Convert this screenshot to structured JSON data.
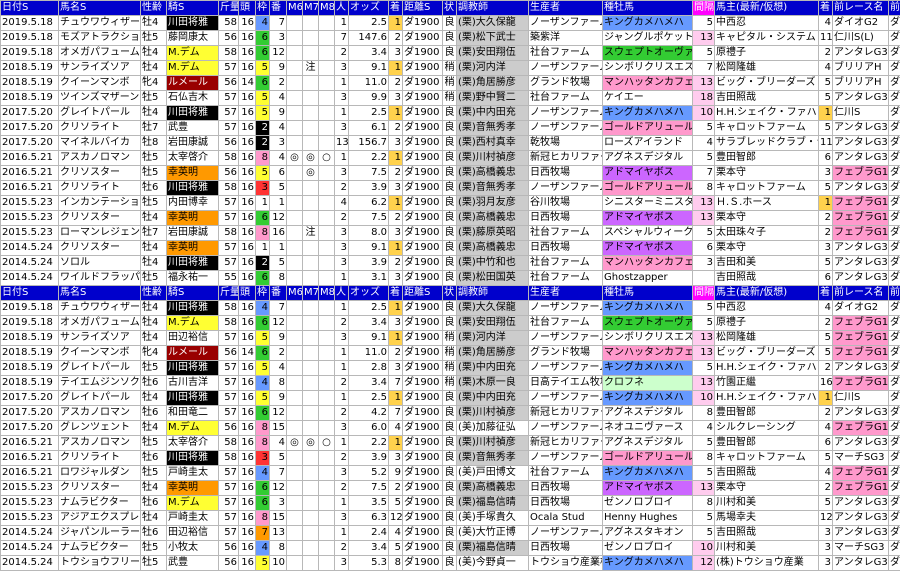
{
  "header": [
    "日付S",
    "馬名S",
    "性齢",
    "騎S",
    "斤量",
    "頭",
    "枠",
    "番",
    "M6",
    "M7",
    "M8",
    "人",
    "オッズ",
    "着",
    "距離S",
    "状",
    "調教師",
    "生産者",
    "種牡馬",
    "間隔",
    "馬主(最新/仮想)",
    "着",
    "前レース名",
    "前距離",
    "人"
  ],
  "header2": [
    "日付S",
    "馬名S",
    "性齢",
    "騎S",
    "斤量",
    "頭",
    "枠",
    "番",
    "M6",
    "M7",
    "M8",
    "人",
    "オッズ",
    "着",
    "距離S",
    "状",
    "調教師",
    "生産者",
    "種牡馬",
    "間隔",
    "馬主(最新/仮想)",
    "着",
    "前レース名",
    "前距離",
    "人"
  ],
  "rows1": [
    [
      "2019.5.18",
      "チュウワウィザード",
      "牡4",
      "川田将雅",
      "58",
      "16",
      "4",
      "7",
      "",
      "",
      "",
      "1",
      "2.5",
      "1",
      "ダ1900",
      "良",
      "(栗)大久保龍",
      "ノーザンファーム",
      "キングカメハメハ",
      "5",
      "中西忍",
      "4",
      "ダイオG2",
      "ダ2400",
      "1"
    ],
    [
      "2019.5.18",
      "モズアトラクション",
      "牡5",
      "藤岡康太",
      "56",
      "16",
      "6",
      "3",
      "",
      "",
      "",
      "7",
      "147.6",
      "2",
      "ダ1900",
      "良",
      "(栗)松下武士",
      "築紫洋",
      "ジャングルポケット",
      "13",
      "キャピタル・システム",
      "11",
      "仁川S(L)",
      "ダ2000",
      "3"
    ],
    [
      "2019.5.18",
      "オメガパフューム",
      "牡4",
      "M.デム",
      "58",
      "16",
      "6",
      "12",
      "",
      "",
      "",
      "2",
      "3.4",
      "3",
      "ダ1900",
      "良",
      "(栗)安田翔伍",
      "社台ファーム",
      "スウェプトオーヴァーボード",
      "5",
      "原禮子",
      "2",
      "アンタレG3",
      "ダ1600",
      "3"
    ],
    [
      "2018.5.19",
      "サンライズソア",
      "牡4",
      "M.デム",
      "57",
      "16",
      "5",
      "9",
      "",
      "注",
      "",
      "3",
      "9.1",
      "1",
      "ダ1900",
      "稍",
      "(栗)河内洋",
      "ノーザンファーム",
      "シンボリクリスエス",
      "7",
      "松岡隆雄",
      "4",
      "ブリリアH",
      "ダ2000",
      "1"
    ],
    [
      "2018.5.19",
      "クイーンマンボ",
      "牝4",
      "ルメール",
      "56",
      "14",
      "6",
      "2",
      "",
      "",
      "",
      "1",
      "11.0",
      "2",
      "ダ1900",
      "稍",
      "(栗)角居勝彦",
      "グランド牧場",
      "マンハッタンカフェ",
      "13",
      "ビッグ・ブリーダーズ・ファーム",
      "5",
      "ブリリアH",
      "ダ1600",
      "1"
    ],
    [
      "2018.5.19",
      "ツインズマザーン",
      "牡5",
      "石仏吉木",
      "57",
      "16",
      "5",
      "4",
      "",
      "",
      "",
      "3",
      "9.9",
      "3",
      "ダ1900",
      "稍",
      "(栗)野中賢二",
      "社台ファーム",
      "ケイエー",
      "18",
      "吉田照哉",
      "5",
      "アンタレG3",
      "ダ1800",
      "1"
    ],
    [
      "2017.5.20",
      "グレイトパール",
      "牡4",
      "川田将雅",
      "57",
      "16",
      "5",
      "9",
      "",
      "",
      "",
      "1",
      "2.5",
      "1",
      "ダ1900",
      "良",
      "(栗)中内田充",
      "ノーザンファーム",
      "キングカメハメハ",
      "10",
      "H.H.シェイク・ファハド",
      "1",
      "仁川S",
      "ダ2000",
      "1"
    ],
    [
      "2017.5.20",
      "クリソライト",
      "牡7",
      "武豊",
      "57",
      "16",
      "2",
      "4",
      "",
      "",
      "",
      "3",
      "6.1",
      "2",
      "ダ1900",
      "良",
      "(栗)音無秀孝",
      "ノーザンファーム",
      "ゴールドアリュール",
      "5",
      "キャロットファーム",
      "5",
      "アンタレG3",
      "ダ1800",
      "1"
    ],
    [
      "2017.5.20",
      "マイネルバイカ",
      "牡8",
      "岩田康誠",
      "56",
      "16",
      "2",
      "3",
      "",
      "",
      "",
      "13",
      "156.7",
      "3",
      "ダ1900",
      "良",
      "(栗)西村真幸",
      "乾牧場",
      "ローズアイランド",
      "4",
      "サラブレッドクラブ・ラフィアン",
      "11",
      "アンタレG3",
      "ダ1800",
      "14"
    ],
    [
      "2016.5.21",
      "アスカノロマン",
      "牡5",
      "太宰啓介",
      "58",
      "16",
      "8",
      "4",
      "◎",
      "◎",
      "○",
      "1",
      "2.2",
      "1",
      "ダ1900",
      "良",
      "(栗)川村禎彦",
      "新冠ヒカリファーム",
      "アグネスデジタル",
      "5",
      "豊田智郎",
      "6",
      "アンタレG3",
      "ダ1800",
      "1"
    ],
    [
      "2016.5.21",
      "クリソスター",
      "牡5",
      "幸英明",
      "56",
      "16",
      "5",
      "6",
      "",
      "◎",
      "",
      "3",
      "7.5",
      "2",
      "ダ1900",
      "良",
      "(栗)高橋義忠",
      "日西牧場",
      "アドマイヤボス",
      "7",
      "栗本守",
      "3",
      "フェブラG1",
      "ダ1600",
      "3"
    ],
    [
      "2016.5.21",
      "クリソライト",
      "牡6",
      "川田将雅",
      "58",
      "16",
      "3",
      "5",
      "",
      "",
      "",
      "2",
      "3.9",
      "3",
      "ダ1900",
      "良",
      "(栗)音無秀孝",
      "ノーザンファーム",
      "ゴールドアリュール",
      "8",
      "キャロットファーム",
      "5",
      "アンタレG3",
      "ダ1800",
      "1"
    ],
    [
      "2015.5.23",
      "インカンテーション",
      "牡5",
      "内田博幸",
      "57",
      "16",
      "1",
      "1",
      "",
      "",
      "",
      "4",
      "6.2",
      "1",
      "ダ1900",
      "良",
      "(栗)羽月友彦",
      "谷川牧場",
      "シニスターミニスター",
      "13",
      "Ｈ.Ｓ.ホース",
      "1",
      "フェブラG1",
      "ダ1600",
      "4"
    ],
    [
      "2015.5.23",
      "クリソスター",
      "牡4",
      "幸英明",
      "57",
      "16",
      "6",
      "12",
      "",
      "",
      "",
      "2",
      "7.5",
      "2",
      "ダ1900",
      "良",
      "(栗)高橋義忠",
      "日西牧場",
      "アドマイヤボス",
      "13",
      "栗本守",
      "2",
      "フェブラG1",
      "ダ1600",
      "2"
    ],
    [
      "2015.5.23",
      "ローマンレジェンド",
      "牡7",
      "岩田康誠",
      "58",
      "16",
      "8",
      "16",
      "",
      "注",
      "",
      "3",
      "8.0",
      "3",
      "ダ1900",
      "良",
      "(栗)藤原英昭",
      "社台ファーム",
      "スペシャルウィーク",
      "5",
      "太田珠々子",
      "2",
      "フェブラG1",
      "ダ1600",
      "2"
    ],
    [
      "2014.5.24",
      "クリソスター",
      "牡4",
      "幸英明",
      "57",
      "16",
      "1",
      "1",
      "",
      "",
      "",
      "3",
      "9.1",
      "1",
      "ダ1900",
      "良",
      "(栗)高橋義忠",
      "日西牧場",
      "アドマイヤボス",
      "6",
      "栗本守",
      "3",
      "アンタレG3",
      "ダ1800",
      "3"
    ],
    [
      "2014.5.24",
      "ソロル",
      "牡4",
      "川田将雅",
      "57",
      "16",
      "2",
      "5",
      "",
      "",
      "",
      "3",
      "3.9",
      "2",
      "ダ1900",
      "良",
      "(栗)中竹和也",
      "社台ファーム",
      "マンハッタンカフェ",
      "3",
      "吉田和美",
      "5",
      "アンタレG3",
      "ダ1800",
      "1"
    ],
    [
      "2014.5.24",
      "ワイルドフラッパー",
      "牡5",
      "福永祐一",
      "55",
      "16",
      "6",
      "8",
      "",
      "",
      "",
      "1",
      "3.1",
      "3",
      "ダ1900",
      "良",
      "(栗)松田国英",
      "社台ファーム",
      "Ghostzapper",
      "",
      "吉田照哉",
      "6",
      "アンタレG3",
      "ダ1800",
      "2"
    ]
  ],
  "rows2": [
    [
      "2019.5.18",
      "チュウワウィザード",
      "牡4",
      "川田将雅",
      "58",
      "16",
      "4",
      "7",
      "",
      "",
      "",
      "1",
      "2.5",
      "1",
      "ダ1900",
      "良",
      "(栗)大久保龍",
      "ノーザンファーム",
      "キングカメハメハ",
      "5",
      "中西忍",
      "4",
      "ダイオG2",
      "ダ2400",
      "1"
    ],
    [
      "2019.5.18",
      "オメガパフューム",
      "牡4",
      "M.デム",
      "58",
      "16",
      "6",
      "12",
      "",
      "",
      "",
      "2",
      "3.4",
      "3",
      "ダ1900",
      "良",
      "(栗)安田翔伍",
      "社台ファーム",
      "スウェプトオーヴァーボード",
      "5",
      "原禮子",
      "2",
      "フェブラG1",
      "ダ1600",
      "3"
    ],
    [
      "2018.5.19",
      "サンライズソア",
      "牡4",
      "田辺裕信",
      "57",
      "16",
      "5",
      "9",
      "",
      "",
      "",
      "3",
      "9.1",
      "1",
      "ダ1900",
      "稍",
      "(栗)河内洋",
      "ノーザンファーム",
      "シンボリクリスエス",
      "13",
      "松岡隆雄",
      "5",
      "フェブラG1",
      "ダ1600",
      "3"
    ],
    [
      "2018.5.19",
      "クイーンマンボ",
      "牝4",
      "ルメール",
      "56",
      "14",
      "6",
      "2",
      "",
      "",
      "",
      "1",
      "11.0",
      "2",
      "ダ1900",
      "稍",
      "(栗)角居勝彦",
      "グランド牧場",
      "マンハッタンカフェ",
      "13",
      "ビッグ・ブリーダーズ・ファーム",
      "5",
      "フェブラG1",
      "ダ1600",
      "1"
    ],
    [
      "2018.5.19",
      "グレイトパール",
      "牡5",
      "川田将雅",
      "57",
      "16",
      "5",
      "4",
      "",
      "",
      "",
      "1",
      "2.8",
      "3",
      "ダ1900",
      "稍",
      "(栗)中内田充",
      "ノーザンファーム",
      "キングカメハメハ",
      "5",
      "H.H.シェイク・ファハド",
      "2",
      "アンタレG3",
      "ダ1800",
      "1"
    ],
    [
      "2018.5.19",
      "テイエムジンソク",
      "牡6",
      "古川吉洋",
      "57",
      "16",
      "4",
      "8",
      "",
      "",
      "",
      "2",
      "3.4",
      "7",
      "ダ1900",
      "稍",
      "(栗)木原一良",
      "日高テイエム牧場",
      "クロフネ",
      "13",
      "竹園正繼",
      "16",
      "フェブラG1",
      "ダ1600",
      "2"
    ],
    [
      "2017.5.20",
      "グレイトパール",
      "牡4",
      "川田将雅",
      "57",
      "16",
      "5",
      "9",
      "",
      "",
      "",
      "1",
      "2.5",
      "1",
      "ダ1900",
      "良",
      "(栗)中内田充",
      "ノーザンファーム",
      "キングカメハメハ",
      "10",
      "H.H.シェイク・ファハド",
      "1",
      "仁川S",
      "ダ2000",
      "1"
    ],
    [
      "2017.5.20",
      "アスカノロマン",
      "牡6",
      "和田竜二",
      "57",
      "16",
      "6",
      "12",
      "",
      "",
      "",
      "2",
      "4.2",
      "7",
      "ダ1900",
      "良",
      "(栗)川村禎彦",
      "新冠ヒカリファーム",
      "アグネスデジタル",
      "8",
      "豊田智郎",
      "2",
      "アンタレG3",
      "ダ1800",
      "3"
    ],
    [
      "2017.5.20",
      "グレンツェント",
      "牡4",
      "M.デム",
      "56",
      "16",
      "8",
      "15",
      "",
      "",
      "",
      "3",
      "6.0",
      "4",
      "ダ1900",
      "良",
      "(美)加藤征弘",
      "ノーザンファーム",
      "ネオユニヴァース",
      "4",
      "シルクレーシング",
      "4",
      "フェブラG1",
      "ダ1600",
      "3"
    ],
    [
      "2016.5.21",
      "アスカノロマン",
      "牡5",
      "太宰啓介",
      "58",
      "16",
      "8",
      "4",
      "◎",
      "◎",
      "○",
      "1",
      "2.2",
      "1",
      "ダ1900",
      "良",
      "(栗)川村禎彦",
      "新冠ヒカリファーム",
      "アグネスデジタル",
      "5",
      "豊田智郎",
      "6",
      "アンタレG3",
      "ダ1800",
      "1"
    ],
    [
      "2016.5.21",
      "クリソライト",
      "牡6",
      "川田将雅",
      "58",
      "16",
      "3",
      "5",
      "",
      "",
      "",
      "2",
      "3.9",
      "3",
      "ダ1900",
      "良",
      "(栗)音無秀孝",
      "ノーザンファーム",
      "ゴールドアリュール",
      "8",
      "キャロットファーム",
      "5",
      "マーチSG3",
      "ダ1800",
      "2"
    ],
    [
      "2016.5.21",
      "ロワジャルダン",
      "牡5",
      "戸崎圭太",
      "57",
      "16",
      "4",
      "7",
      "",
      "",
      "",
      "3",
      "5.2",
      "9",
      "ダ1900",
      "良",
      "(美)戸田博文",
      "社台ファーム",
      "キングカメハメハ",
      "5",
      "吉田照哉",
      "4",
      "フェブラG1",
      "ダ1600",
      "3"
    ],
    [
      "2015.5.23",
      "クリソスター",
      "牡4",
      "幸英明",
      "57",
      "16",
      "6",
      "12",
      "",
      "",
      "",
      "2",
      "7.5",
      "2",
      "ダ1900",
      "良",
      "(栗)高橋義忠",
      "日西牧場",
      "アドマイヤボス",
      "13",
      "栗本守",
      "2",
      "フェブラG1",
      "ダ1600",
      "2"
    ],
    [
      "2015.5.23",
      "ナムラビクター",
      "牡6",
      "M.デム",
      "57",
      "16",
      "6",
      "3",
      "",
      "",
      "",
      "1",
      "3.5",
      "5",
      "ダ1900",
      "良",
      "(栗)福島信晴",
      "日西牧場",
      "ゼンノロブロイ",
      "8",
      "川村和美",
      "5",
      "アンタレG3",
      "ダ1800",
      "3"
    ],
    [
      "2015.5.23",
      "アジアエクスプレス",
      "牡4",
      "戸崎圭太",
      "57",
      "16",
      "8",
      "15",
      "",
      "",
      "",
      "3",
      "6.3",
      "12",
      "ダ1900",
      "良",
      "(美)手塚貴久",
      "Ocala Stud",
      "Henny Hughes",
      "5",
      "馬場幸夫",
      "12",
      "アンタレG3",
      "ダ1800",
      "1"
    ],
    [
      "2014.5.24",
      "ジャパンルーラー",
      "牡6",
      "田辺裕信",
      "57",
      "16",
      "7",
      "13",
      "",
      "",
      "",
      "1",
      "2.4",
      "4",
      "ダ1900",
      "良",
      "(美)大竹正博",
      "ノーザンファーム",
      "アグネスタキオン",
      "5",
      "吉田照哉",
      "3",
      "アンタレG3",
      "ダ1800",
      "3"
    ],
    [
      "2014.5.24",
      "ナムラビクター",
      "牡5",
      "小牧太",
      "56",
      "16",
      "4",
      "8",
      "",
      "",
      "",
      "2",
      "3.4",
      "5",
      "ダ1900",
      "良",
      "(栗)福島信晴",
      "日西牧場",
      "ゼンノロブロイ",
      "10",
      "川村和美",
      "3",
      "マーチSG3",
      "ダ1800",
      "1"
    ],
    [
      "2014.5.24",
      "トウショウフリーク",
      "牡5",
      "武豊",
      "56",
      "16",
      "5",
      "10",
      "",
      "",
      "",
      "3",
      "5.3",
      "8",
      "ダ1900",
      "良",
      "(美)今野貞一",
      "トウショウ産業株式会社",
      "キングカメハメハ",
      "12",
      "(株)トウショウ産業",
      "3",
      "アンタレG3",
      "ダ1800",
      "3"
    ]
  ]
}
